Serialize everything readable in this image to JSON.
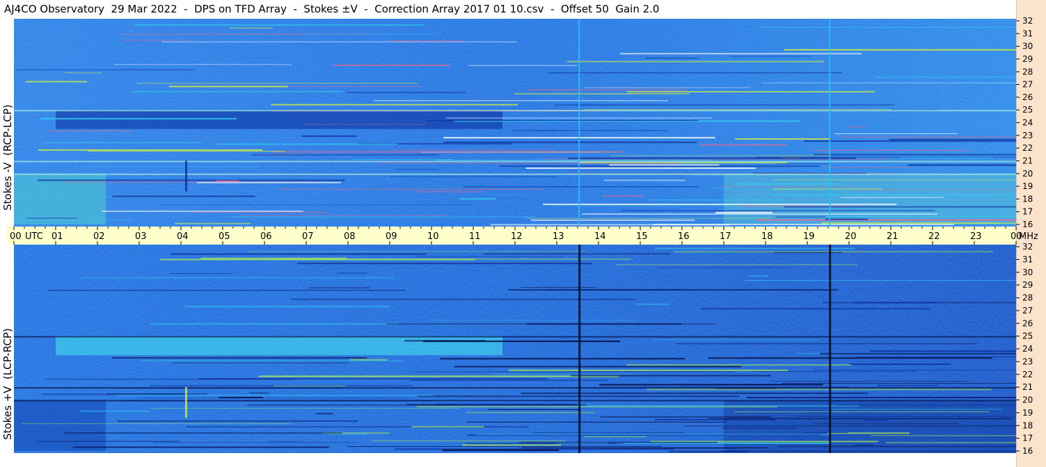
{
  "title": "AJ4CO Observatory  29 Mar 2022  -  DPS on TFD Array  -  Stokes ±V  -  Correction Array 2017 01 10.csv  -  Offset 50  Gain 2.0",
  "colors": {
    "time_axis_bg": "#ffffcc",
    "freq_strip_bg": "#fbe3cc",
    "plot_base": "#1a66e6",
    "plot_dark": "#0a2a9a",
    "plot_bright": "#33ccee",
    "plot_yellow": "#ccee44"
  },
  "chart_data": {
    "type": "heatmap",
    "x_axis": {
      "label": "UTC",
      "ticks": [
        "00",
        "01",
        "02",
        "03",
        "04",
        "05",
        "06",
        "07",
        "08",
        "09",
        "10",
        "11",
        "12",
        "13",
        "14",
        "15",
        "16",
        "17",
        "18",
        "19",
        "20",
        "21",
        "22",
        "23",
        "00"
      ],
      "unit_label": "MHz",
      "range": [
        0,
        24
      ]
    },
    "y_axis": {
      "unit": "MHz",
      "ticks": [
        16,
        17,
        18,
        19,
        20,
        21,
        22,
        23,
        24,
        25,
        26,
        27,
        28,
        29,
        30,
        31,
        32
      ],
      "range": [
        16,
        32
      ]
    },
    "panels": [
      {
        "name": "stokes_minus_v",
        "ylabel": "Stokes -V  (RCP-LCP)"
      },
      {
        "name": "stokes_plus_v",
        "ylabel": "Stokes +V  (LCP-RCP)"
      }
    ]
  }
}
